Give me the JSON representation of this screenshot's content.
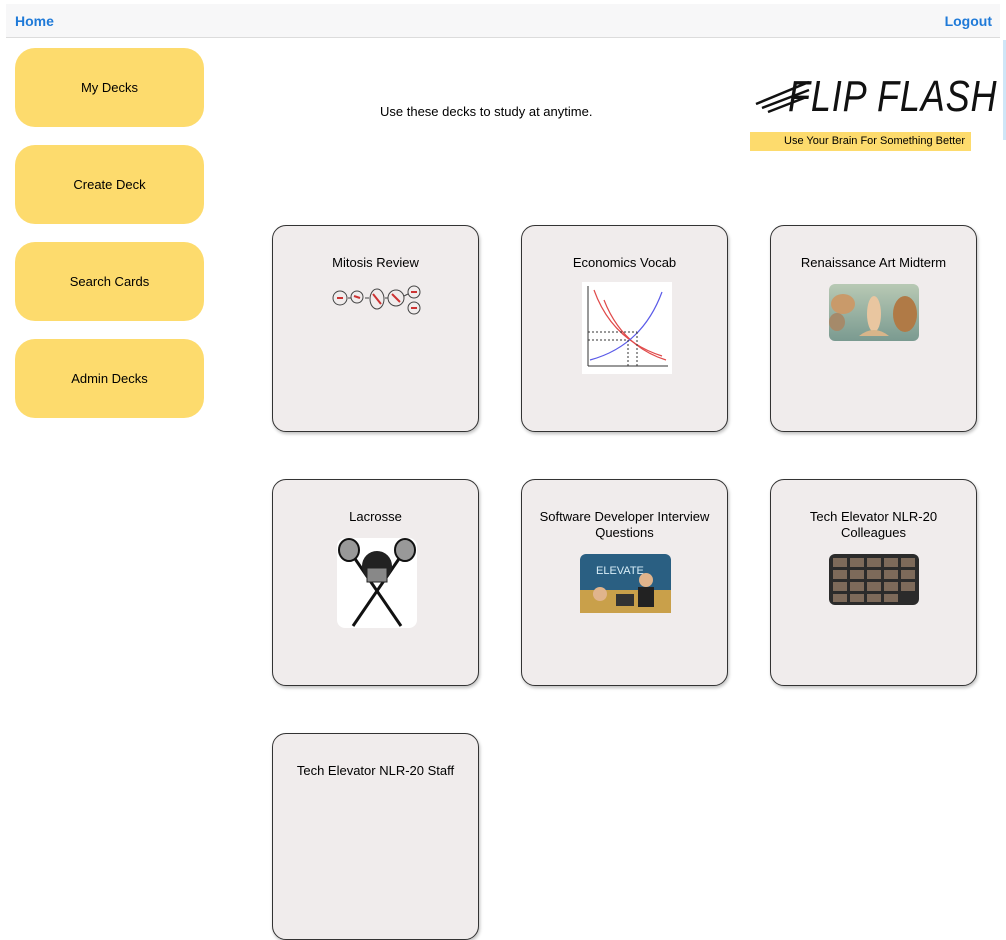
{
  "nav": {
    "home": "Home",
    "logout": "Logout"
  },
  "sidebar": {
    "items": [
      {
        "label": "My Decks"
      },
      {
        "label": "Create Deck"
      },
      {
        "label": "Search Cards"
      },
      {
        "label": "Admin Decks"
      }
    ]
  },
  "main": {
    "tagline": "Use these decks to study at anytime.",
    "logo": {
      "title": "FLIP FLASH",
      "slogan": "Use Your Brain For Something Better"
    },
    "decks": [
      {
        "title": "Mitosis Review"
      },
      {
        "title": "Economics Vocab"
      },
      {
        "title": "Renaissance Art Midterm"
      },
      {
        "title": "Lacrosse"
      },
      {
        "title": "Software Developer Interview Questions"
      },
      {
        "title": "Tech Elevator NLR-20 Colleagues"
      },
      {
        "title": "Tech Elevator NLR-20 Staff"
      }
    ]
  },
  "colors": {
    "accent": "#fddb6d",
    "link": "#1f7ad8",
    "card_bg": "#f0ecec"
  }
}
